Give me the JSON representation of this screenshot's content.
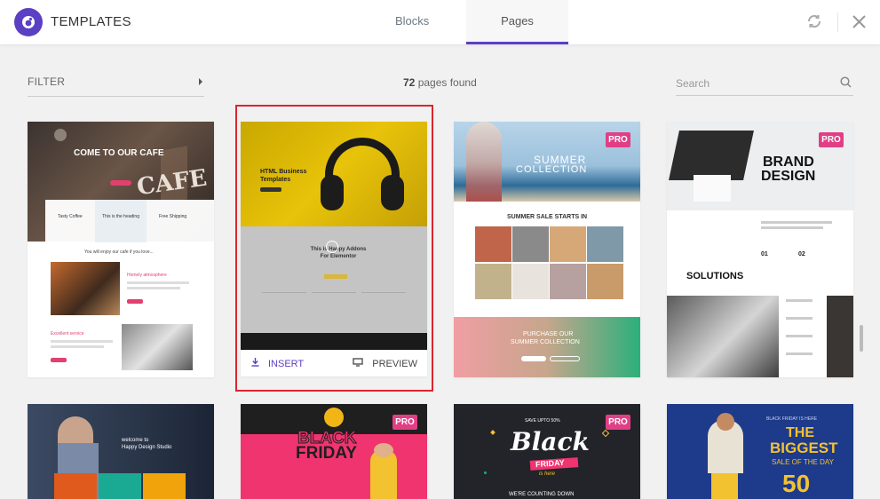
{
  "header": {
    "title": "TEMPLATES",
    "tabs": [
      {
        "label": "Blocks"
      },
      {
        "label": "Pages"
      }
    ],
    "active_tab": "Pages"
  },
  "toolbar": {
    "filter_label": "FILTER",
    "count_number": "72",
    "count_suffix": " pages found",
    "search_placeholder": "Search"
  },
  "cards": [
    {
      "name": "cafe",
      "pro": false,
      "texts": {
        "hero": "COME TO OUR CAFE",
        "sign": "CAFE",
        "f1": "Tasty Coffee",
        "f2": "This is the heading",
        "f3": "Free Shipping",
        "enjoy": "You will enjoy our cafe if you love...",
        "s1": "Homely atmosphere",
        "s2": "Excellent service"
      }
    },
    {
      "name": "html-business",
      "pro": false,
      "selected": true,
      "texts": {
        "hero": "HTML Business Templates",
        "section": "This is Happy Addons For Elementor"
      },
      "insert_label": "INSERT",
      "preview_label": "PREVIEW"
    },
    {
      "name": "summer-collection",
      "pro": true,
      "texts": {
        "hero1": "SUMMER",
        "hero2": "COLLECTION",
        "sale": "SUMMER SALE STARTS IN",
        "purchase1": "PURCHASE OUR",
        "purchase2": "SUMMER COLLECTION"
      }
    },
    {
      "name": "brand-design",
      "pro": true,
      "texts": {
        "brand1": "BRAND",
        "brand2": "DESIGN",
        "n1": "01",
        "n2": "02",
        "solutions": "SOLUTIONS"
      }
    },
    {
      "name": "happy-design-studio",
      "pro": false,
      "texts": {
        "welcome1": "welcome to",
        "welcome2": "Happy Design Studio"
      }
    },
    {
      "name": "black-friday-pink",
      "pro": true,
      "texts": {
        "l1": "BLACK",
        "l2": "FRIDAY"
      }
    },
    {
      "name": "black-friday-dark",
      "pro": true,
      "texts": {
        "save": "SAVE UPTO 50%",
        "l1": "Black",
        "l2": "FRIDAY",
        "l3": "is here",
        "counting": "WE'RE COUNTING DOWN"
      }
    },
    {
      "name": "biggest-sale",
      "pro": false,
      "texts": {
        "top": "BLACK FRIDAY IS HERE",
        "big1": "THE",
        "big2": "BIGGEST",
        "sub": "SALE OF THE DAY",
        "num": "50"
      }
    }
  ],
  "pro_label": "PRO",
  "colors": {
    "accent": "#5b3fc4",
    "pro": "#e03f86",
    "selection": "#d9262c"
  }
}
